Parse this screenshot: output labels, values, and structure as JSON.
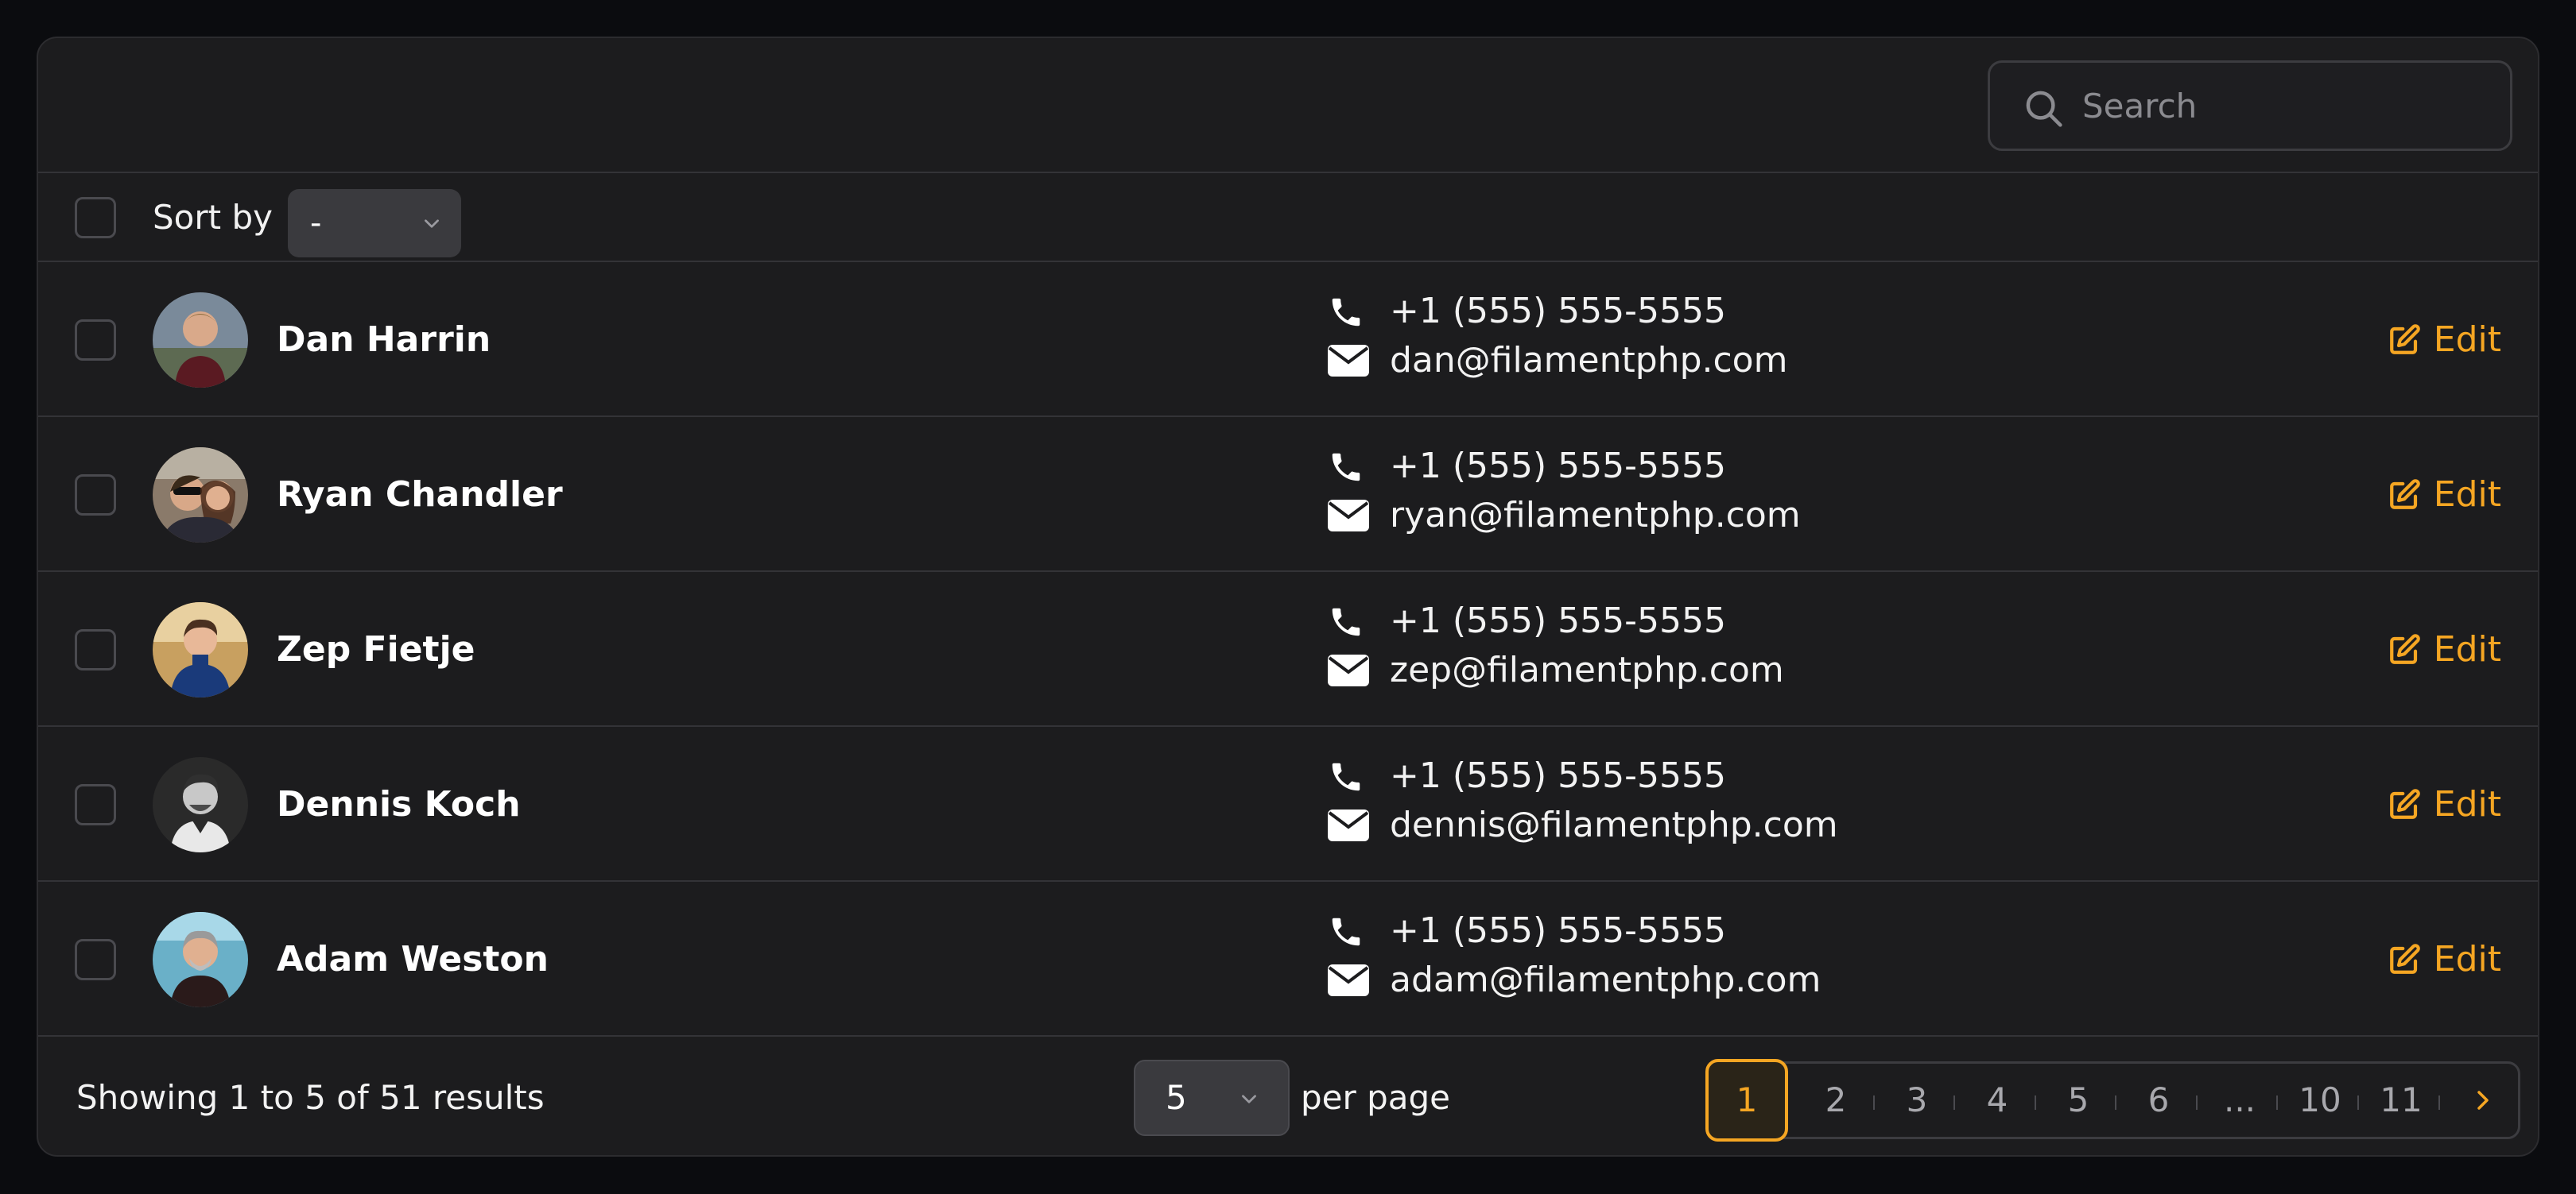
{
  "search": {
    "placeholder": "Search"
  },
  "sort": {
    "label": "Sort by",
    "value": "-"
  },
  "rows": [
    {
      "name": "Dan Harrin",
      "phone": "+1 (555) 555-5555",
      "email": "dan@filamentphp.com",
      "edit": "Edit"
    },
    {
      "name": "Ryan Chandler",
      "phone": "+1 (555) 555-5555",
      "email": "ryan@filamentphp.com",
      "edit": "Edit"
    },
    {
      "name": "Zep Fietje",
      "phone": "+1 (555) 555-5555",
      "email": "zep@filamentphp.com",
      "edit": "Edit"
    },
    {
      "name": "Dennis Koch",
      "phone": "+1 (555) 555-5555",
      "email": "dennis@filamentphp.com",
      "edit": "Edit"
    },
    {
      "name": "Adam Weston",
      "phone": "+1 (555) 555-5555",
      "email": "adam@filamentphp.com",
      "edit": "Edit"
    }
  ],
  "footer": {
    "results": "Showing 1 to 5 of 51 results",
    "per_page_value": "5",
    "per_page_label": "per page",
    "pages": [
      "1",
      "2",
      "3",
      "4",
      "5",
      "6",
      "...",
      "10",
      "11"
    ],
    "active_page": "1"
  },
  "colors": {
    "accent": "#f5a623",
    "background": "#1c1c1e",
    "border": "#333337"
  },
  "icons": {
    "search": "search-icon",
    "phone": "phone-icon",
    "mail": "mail-icon",
    "edit": "edit-icon",
    "chevron": "chevron-down-icon",
    "next": "chevron-right-icon"
  }
}
